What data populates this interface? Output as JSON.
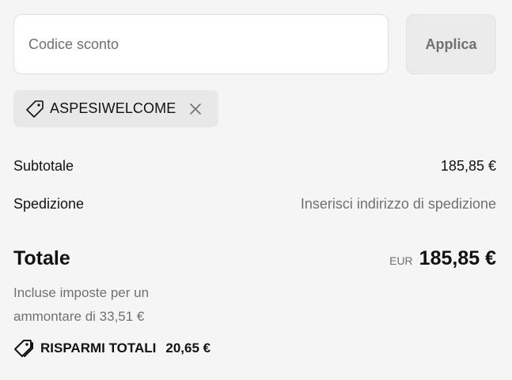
{
  "discount": {
    "input_value": "",
    "placeholder": "Codice sconto",
    "apply_label": "Applica"
  },
  "applied_code": {
    "code": "ASPESIWELCOME",
    "icon": "tag-icon",
    "remove_icon": "close-icon"
  },
  "summary": {
    "subtotal_label": "Subtotale",
    "subtotal_value": "185,85 €",
    "shipping_label": "Spedizione",
    "shipping_value": "Inserisci indirizzo di spedizione"
  },
  "total": {
    "label": "Totale",
    "currency": "EUR",
    "value": "185,85 €",
    "tax_note": "Incluse imposte per un ammontare di 33,51 €"
  },
  "savings": {
    "icon": "tags-icon",
    "label": "RISPARMI TOTALI",
    "value": "20,65 €"
  },
  "colors": {
    "background": "#f5f5f5",
    "text": "#121212",
    "muted": "#707070",
    "chip": "#e8e8e8"
  }
}
